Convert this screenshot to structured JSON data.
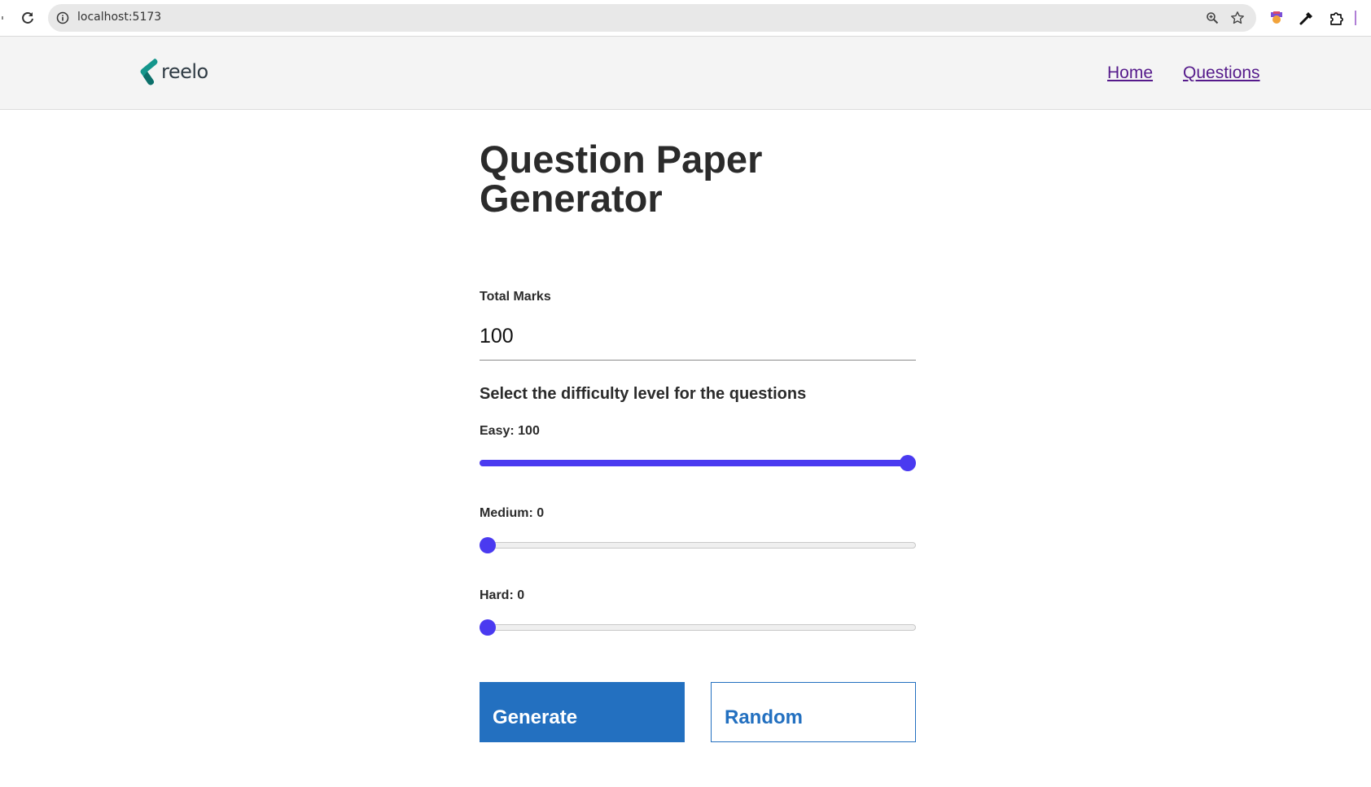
{
  "browser": {
    "url": "localhost:5173"
  },
  "header": {
    "logo_text": "reelo",
    "nav": {
      "home": "Home",
      "questions": "Questions"
    }
  },
  "main": {
    "title": "Question Paper Generator",
    "total_marks": {
      "label": "Total Marks",
      "value": "100"
    },
    "difficulty_heading": "Select the difficulty level for the questions",
    "sliders": {
      "easy": {
        "label": "Easy: 100",
        "value": 100,
        "max": 100
      },
      "medium": {
        "label": "Medium: 0",
        "value": 0,
        "max": 100
      },
      "hard": {
        "label": "Hard: 0",
        "value": 0,
        "max": 100
      }
    },
    "buttons": {
      "generate": "Generate",
      "random": "Random"
    }
  },
  "colors": {
    "accent": "#4a3af0",
    "primary_button": "#2370c0",
    "link": "#551a8b",
    "header_bg": "#f4f4f4",
    "logo_teal": "#14968c"
  }
}
